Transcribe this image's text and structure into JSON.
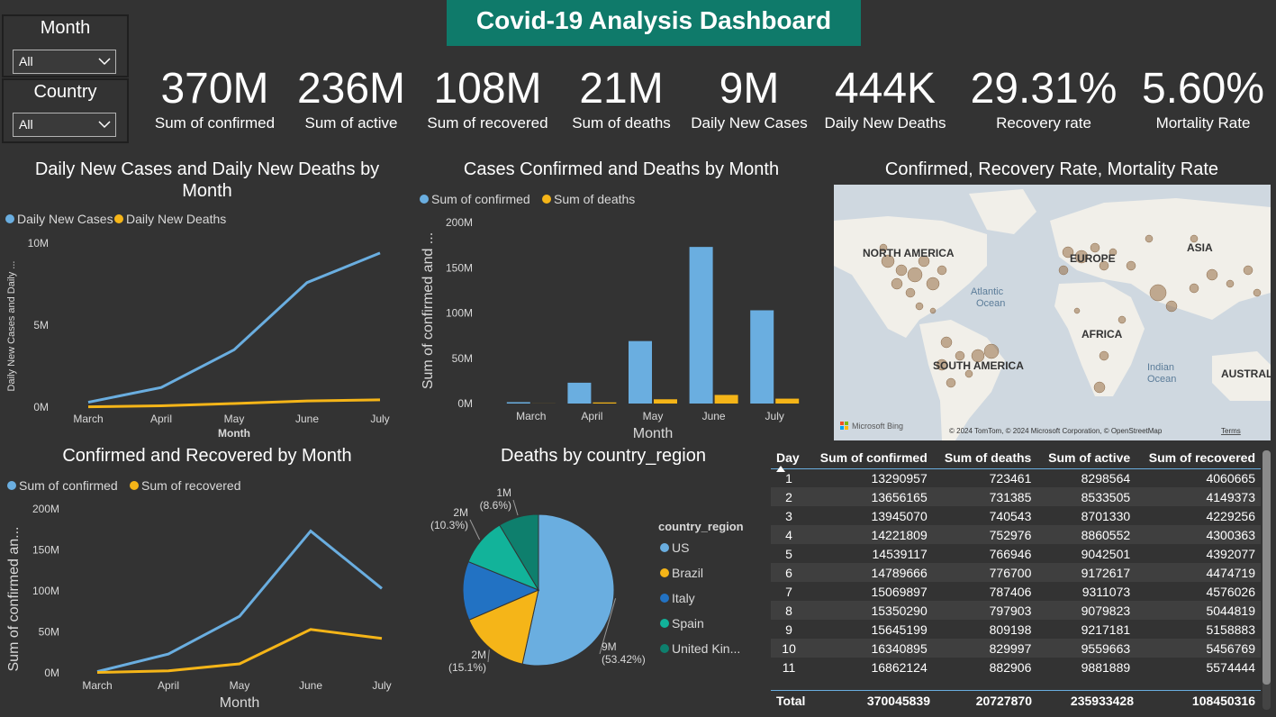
{
  "title": "Covid-19 Analysis Dashboard",
  "slicers": [
    {
      "title": "Month",
      "value": "All"
    },
    {
      "title": "Country",
      "value": "All"
    }
  ],
  "kpis": [
    {
      "value": "370M",
      "label": "Sum of confirmed"
    },
    {
      "value": "236M",
      "label": "Sum of active"
    },
    {
      "value": "108M",
      "label": "Sum of recovered"
    },
    {
      "value": "21M",
      "label": "Sum of deaths"
    },
    {
      "value": "9M",
      "label": "Daily New Cases"
    },
    {
      "value": "444K",
      "label": "Daily New Deaths"
    },
    {
      "value": "29.31%",
      "label": "Recovery rate"
    },
    {
      "value": "5.60%",
      "label": "Mortality Rate"
    }
  ],
  "colors": {
    "blue": "#6aaee0",
    "gold": "#f5b518",
    "title_bg": "#0f7a6a",
    "bg": "#333333"
  },
  "map": {
    "title": "Confirmed, Recovery Rate, Mortality Rate",
    "labels": [
      "NORTH AMERICA",
      "ASIA",
      "EUROPE",
      "Atlantic",
      "Ocean",
      "AFRICA",
      "SOUTH AMERICA",
      "Indian",
      "Ocean",
      "AUSTRAL"
    ],
    "brand": "Microsoft Bing",
    "attribution": "© 2024 TomTom, © 2024 Microsoft Corporation, © OpenStreetMap",
    "terms": "Terms"
  },
  "table": {
    "columns": [
      "Day",
      "Sum of confirmed",
      "Sum of deaths",
      "Sum of active",
      "Sum of recovered"
    ],
    "rows": [
      [
        "1",
        "13290957",
        "723461",
        "8298564",
        "4060665"
      ],
      [
        "2",
        "13656165",
        "731385",
        "8533505",
        "4149373"
      ],
      [
        "3",
        "13945070",
        "740543",
        "8701330",
        "4229256"
      ],
      [
        "4",
        "14221809",
        "752976",
        "8860552",
        "4300363"
      ],
      [
        "5",
        "14539117",
        "766946",
        "9042501",
        "4392077"
      ],
      [
        "6",
        "14789666",
        "776700",
        "9172617",
        "4474719"
      ],
      [
        "7",
        "15069897",
        "787406",
        "9311073",
        "4576026"
      ],
      [
        "8",
        "15350290",
        "797903",
        "9079823",
        "5044819"
      ],
      [
        "9",
        "15645199",
        "809198",
        "9217181",
        "5158883"
      ],
      [
        "10",
        "16340895",
        "829997",
        "9559663",
        "5456769"
      ],
      [
        "11",
        "16862124",
        "882906",
        "9881889",
        "5574444"
      ]
    ],
    "total": [
      "Total",
      "370045839",
      "20727870",
      "235933428",
      "108450316"
    ]
  },
  "chart_data": [
    {
      "type": "line",
      "title": "Daily New Cases and Daily New Deaths by Month",
      "xlabel": "Month",
      "ylabel": "Daily New Cases and Daily ...",
      "categories": [
        "March",
        "April",
        "May",
        "June",
        "July"
      ],
      "y_ticks": [
        "0M",
        "5M",
        "10M"
      ],
      "ylim": [
        0,
        10000000
      ],
      "series": [
        {
          "name": "Daily New Cases",
          "color": "#6aaee0",
          "values": [
            300000,
            1200000,
            3500000,
            7600000,
            9400000
          ]
        },
        {
          "name": "Daily New Deaths",
          "color": "#f5b518",
          "values": [
            20000,
            80000,
            220000,
            380000,
            444000
          ]
        }
      ]
    },
    {
      "type": "bar",
      "title": "Cases Confirmed and Deaths by Month",
      "xlabel": "Month",
      "ylabel": "Sum of confirmed and ...",
      "categories": [
        "March",
        "April",
        "May",
        "June",
        "July"
      ],
      "y_ticks": [
        "0M",
        "50M",
        "100M",
        "150M",
        "200M"
      ],
      "ylim": [
        0,
        200000000
      ],
      "series": [
        {
          "name": "Sum of confirmed",
          "color": "#6aaee0",
          "values": [
            1500000,
            23000000,
            69000000,
            173000000,
            103000000
          ]
        },
        {
          "name": "Sum of deaths",
          "color": "#f5b518",
          "values": [
            80000,
            1200000,
            4700000,
            9500000,
            5400000
          ]
        }
      ]
    },
    {
      "type": "line",
      "title": "Confirmed and Recovered by Month",
      "xlabel": "Month",
      "ylabel": "Sum of confirmed an...",
      "categories": [
        "March",
        "April",
        "May",
        "June",
        "July"
      ],
      "y_ticks": [
        "0M",
        "50M",
        "100M",
        "150M",
        "200M"
      ],
      "ylim": [
        0,
        200000000
      ],
      "series": [
        {
          "name": "Sum of confirmed",
          "color": "#6aaee0",
          "values": [
            1500000,
            23000000,
            69000000,
            173000000,
            103000000
          ]
        },
        {
          "name": "Sum of recovered",
          "color": "#f5b518",
          "values": [
            500000,
            2500000,
            11000000,
            53000000,
            42000000
          ]
        }
      ]
    },
    {
      "type": "pie",
      "title": "Deaths by country_region",
      "legend_title": "country_region",
      "slices": [
        {
          "name": "US",
          "legend": "US",
          "value": 53.42,
          "label": "9M",
          "pct": "(53.42%)",
          "color": "#6aaee0"
        },
        {
          "name": "Brazil",
          "legend": "Brazil",
          "value": 15.1,
          "label": "2M",
          "pct": "(15.1%)",
          "color": "#f5b518"
        },
        {
          "name": "Italy",
          "legend": "Italy",
          "value": 12.58,
          "label": "",
          "pct": "",
          "color": "#2272c3"
        },
        {
          "name": "Spain",
          "legend": "Spain",
          "value": 10.3,
          "label": "2M",
          "pct": "(10.3%)",
          "color": "#12b39a"
        },
        {
          "name": "United Kingdom",
          "legend": "United Kin...",
          "value": 8.6,
          "label": "1M",
          "pct": "(8.6%)",
          "color": "#0e7f6d"
        }
      ]
    }
  ]
}
